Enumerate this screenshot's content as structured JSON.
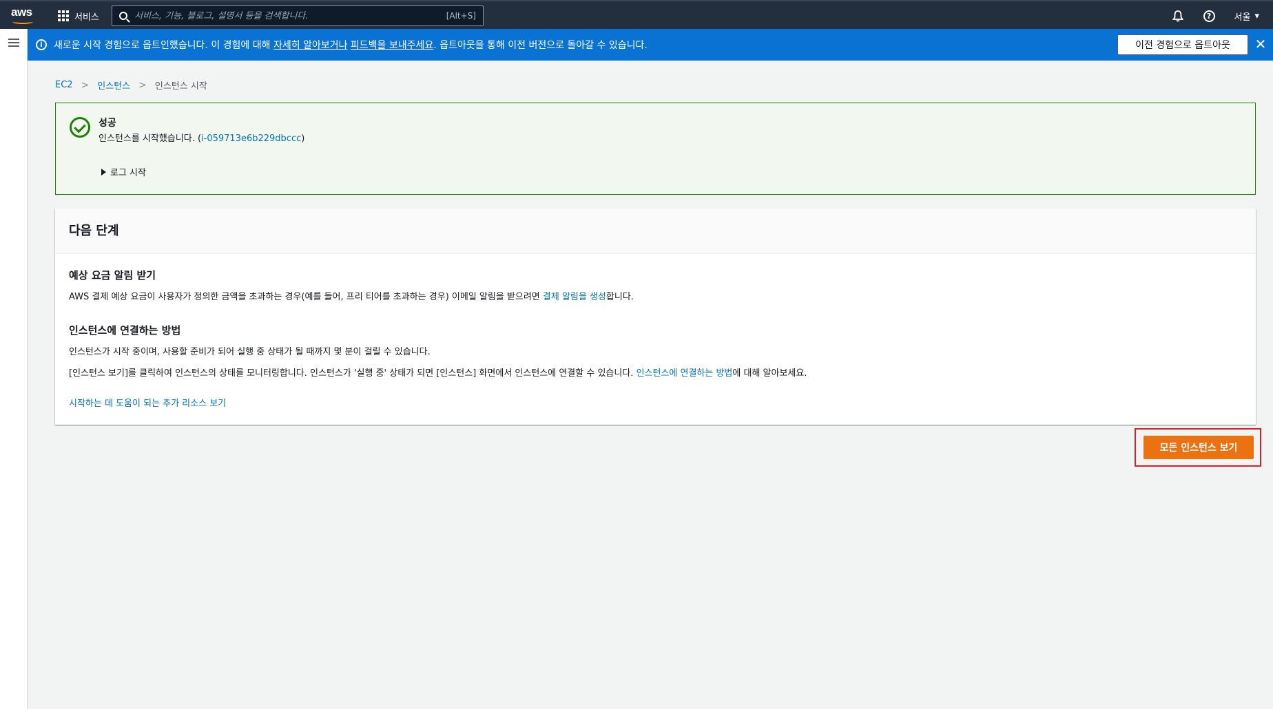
{
  "topnav": {
    "logo": "aws",
    "services_label": "서비스",
    "search_placeholder": "서비스, 기능, 블로그, 설명서 등을 검색합니다.",
    "search_shortcut": "[Alt+S]",
    "region": "서울",
    "icons": [
      "grid-icon",
      "search-icon",
      "bell-icon",
      "help-icon",
      "caret-down-icon"
    ]
  },
  "banner": {
    "text_before": "새로운 시작 경험으로 옵트인했습니다. 이 경험에 대해 ",
    "link1": "자세히 알아보거나",
    "text_mid": " ",
    "link2": "피드백을 보내주세요",
    "text_after": ". 옵트아웃을 통해 이전 버전으로 돌아갈 수 있습니다.",
    "optout_label": "이전 경험으로 옵트아웃",
    "close_symbol": "✕",
    "color": "#0972d3"
  },
  "breadcrumb": {
    "items": [
      "EC2",
      "인스턴스",
      "인스턴스 시작"
    ]
  },
  "success": {
    "title": "성공",
    "message_before": "인스턴스를 시작했습니다. (",
    "instance_id": "i-059713e6b229dbccc",
    "message_after": ")",
    "log_toggle": "로그 시작",
    "color": "#1d8102"
  },
  "next_steps": {
    "title": "다음 단계",
    "billing": {
      "title": "예상 요금 알림 받기",
      "text_before": "AWS 결제 예상 요금이 사용자가 정의한 금액을 초과하는 경우(예를 들어, 프리 티어를 초과하는 경우) 이메일 알림을 받으려면 ",
      "link": "결제 알림을 생성",
      "text_after": "합니다."
    },
    "connect": {
      "title": "인스턴스에 연결하는 방법",
      "line1": "인스턴스가 시작 중이며, 사용할 준비가 되어 실행 중 상태가 될 때까지 몇 분이 걸릴 수 있습니다.",
      "line2_before": "[인스턴스 보기]를 클릭하여 인스턴스의 상태를 모니터링합니다. 인스턴스가 '실행 중' 상태가 되면 [인스턴스] 화면에서 인스턴스에 연결할 수 있습니다. ",
      "line2_link": "인스턴스에 연결하는 방법",
      "line2_after": "에 대해 알아보세요."
    },
    "resources_link": "시작하는 데 도움이 되는 추가 리소스 보기"
  },
  "primary_button": {
    "label": "모든 인스턴스 보기",
    "color": "#ec7211"
  }
}
